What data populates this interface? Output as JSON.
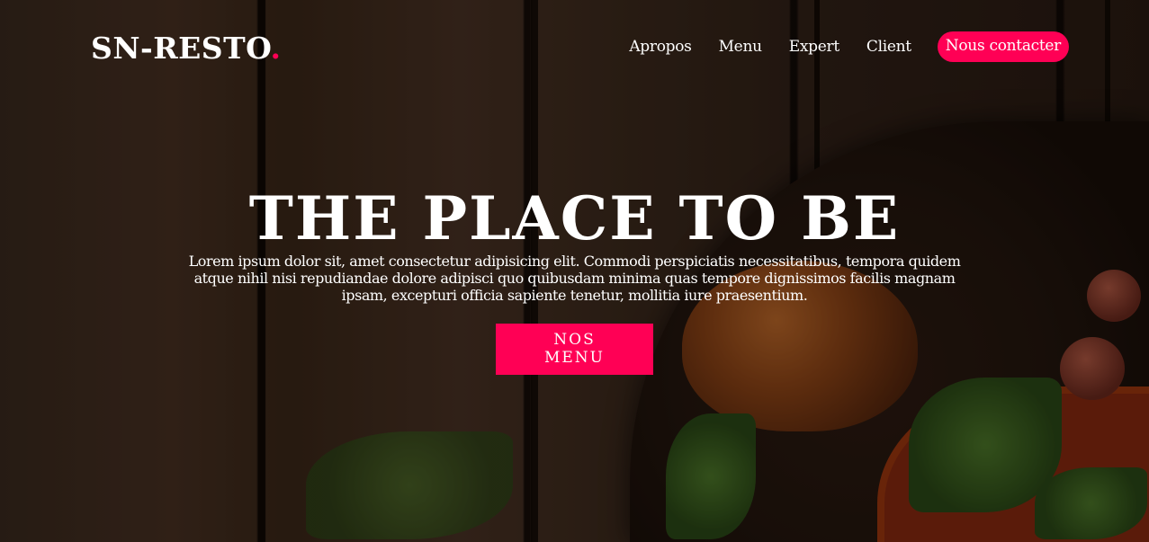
{
  "header": {
    "logo_text": "SN-RESTO",
    "logo_dot": ".",
    "nav": [
      {
        "label": "Apropos"
      },
      {
        "label": "Menu"
      },
      {
        "label": "Expert"
      },
      {
        "label": "Client"
      }
    ],
    "cta_label": "Nous contacter"
  },
  "hero": {
    "title": "THE PLACE TO BE",
    "text": "Lorem ipsum dolor sit, amet consectetur adipisicing elit. Commodi perspiciatis necessitatibus, tempora quidem atque nihil nisi repudiandae dolore adipisci quo quibusdam minima quas tempore dignissimos facilis magnam ipsam, excepturi officia sapiente tenetur, mollitia iure praesentium.",
    "button_label": "NOS MENU"
  },
  "colors": {
    "accent": "#ff0055"
  }
}
